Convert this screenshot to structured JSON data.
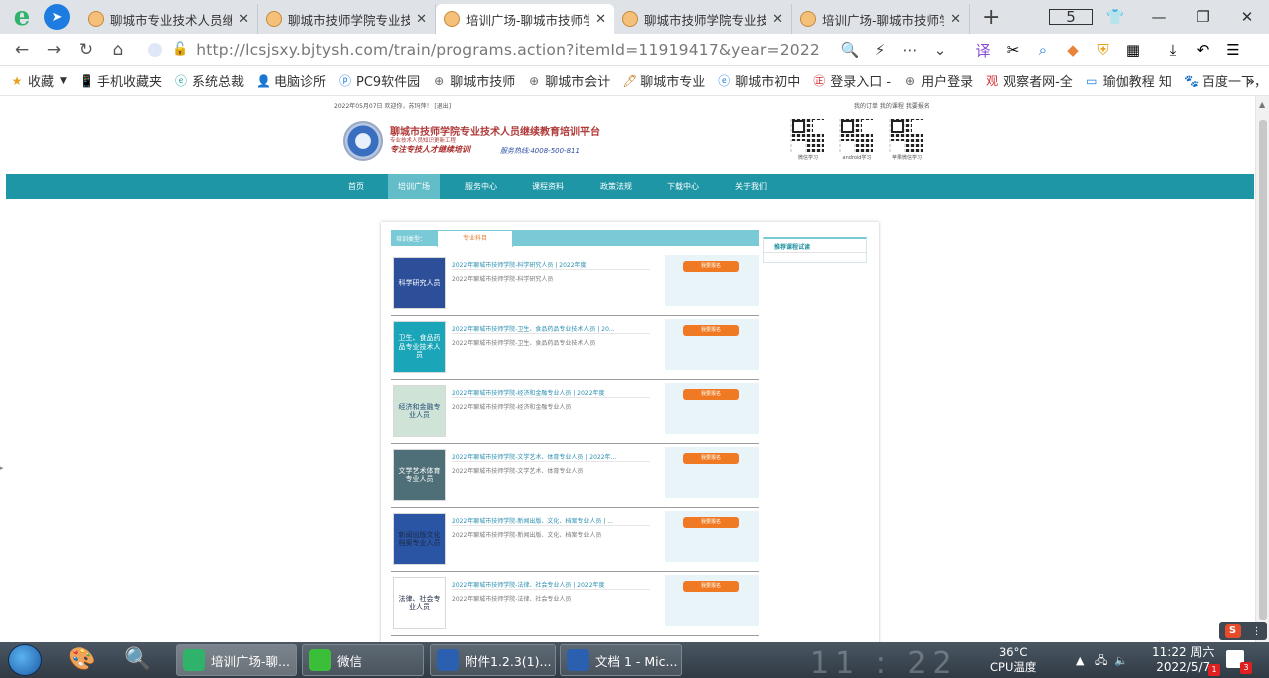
{
  "browser": {
    "tabs": [
      {
        "title": "聊城市专业技术人员继",
        "active": false
      },
      {
        "title": "聊城市技师学院专业技",
        "active": false
      },
      {
        "title": "培训广场-聊城市技师学",
        "active": true
      },
      {
        "title": "聊城市技师学院专业技",
        "active": false
      },
      {
        "title": "培训广场-聊城市技师学",
        "active": false
      }
    ],
    "tab_count": "5",
    "url": "http://lcsjsxy.bjtysh.com/train/programs.action?itemId=11919417&year=2022",
    "bookmarks": [
      "收藏",
      "手机收藏夹",
      "系统总裁",
      "电脑诊所",
      "PC9软件园",
      "聊城市技师",
      "聊城市会计",
      "聊城市专业",
      "聊城市初中",
      "登录入口 -",
      "用户登录",
      "观察者网-全",
      "瑜伽教程 知",
      "百度一下，"
    ]
  },
  "page": {
    "topbar_left": "2022年05月07日 欢迎你，苏玛萍！ [退出]",
    "topbar_right": "我的订单 我的课程 我要报名",
    "site_title": "聊城市技师学院专业技术人员继续教育培训平台",
    "site_sub": "专业技术人员知识更新工程",
    "site_slogan": "专注专技人才继续培训",
    "site_phone": "服务热线:4008-500-811",
    "qr_captions": [
      "微信学习",
      "android学习",
      "苹果微信学习"
    ],
    "nav": [
      "首页",
      "培训广场",
      "服务中心",
      "课程资料",
      "政策法规",
      "下载中心",
      "关于我们"
    ],
    "active_nav": "培训广场",
    "filter_label": "培训类型：",
    "filter_tab": "专业科目",
    "side_title": "推荐课程试读",
    "enroll_label": "我要报名",
    "courses": [
      {
        "title": "2022年聊城市技师学院-科学研究人员 | 2022年度",
        "desc": "2022年聊城市技师学院-科学研究人员",
        "thumb": "科学研究人员",
        "bg": "#2d4f9a",
        "fg": "#ffffff"
      },
      {
        "title": "2022年聊城市技师学院-卫生、食品药品专业技术人员 | 20...",
        "desc": "2022年聊城市技师学院-卫生、食品药品专业技术人员",
        "thumb": "卫生、食品药品专业技术人员",
        "bg": "#1aa6b8",
        "fg": "#ffffff"
      },
      {
        "title": "2022年聊城市技师学院-经济和金融专业人员 | 2022年度",
        "desc": "2022年聊城市技师学院-经济和金融专业人员",
        "thumb": "经济和金融专业人员",
        "bg": "#cfe3d7",
        "fg": "#24507a"
      },
      {
        "title": "2022年聊城市技师学院-文学艺术、体育专业人员 | 2022年...",
        "desc": "2022年聊城市技师学院-文学艺术、体育专业人员",
        "thumb": "文学艺术体育专业人员",
        "bg": "#4f6f78",
        "fg": "#ffffff"
      },
      {
        "title": "2022年聊城市技师学院-新闻出版、文化、档案专业人员 | ...",
        "desc": "2022年聊城市技师学院-新闻出版、文化、档案专业人员",
        "thumb": "新闻出版文化档案专业人员",
        "bg": "#2a55a5",
        "fg": "#1d2a44"
      },
      {
        "title": "2022年聊城市技师学院-法律、社会专业人员 | 2022年度",
        "desc": "2022年聊城市技师学院-法律、社会专业人员",
        "thumb": "法律、社会专业人员",
        "bg": "#ffffff",
        "fg": "#1d2a44"
      }
    ]
  },
  "taskbar": {
    "apps": [
      "培训广场-聊...",
      "微信",
      "附件1.2.3(1)...",
      "文档 1 - Mic..."
    ],
    "big_clock": "11 : 22",
    "temp_value": "36°C",
    "temp_label": "CPU温度",
    "time": "11:22 周六",
    "date": "2022/5/7",
    "badge1": "1",
    "badge2": "3"
  }
}
